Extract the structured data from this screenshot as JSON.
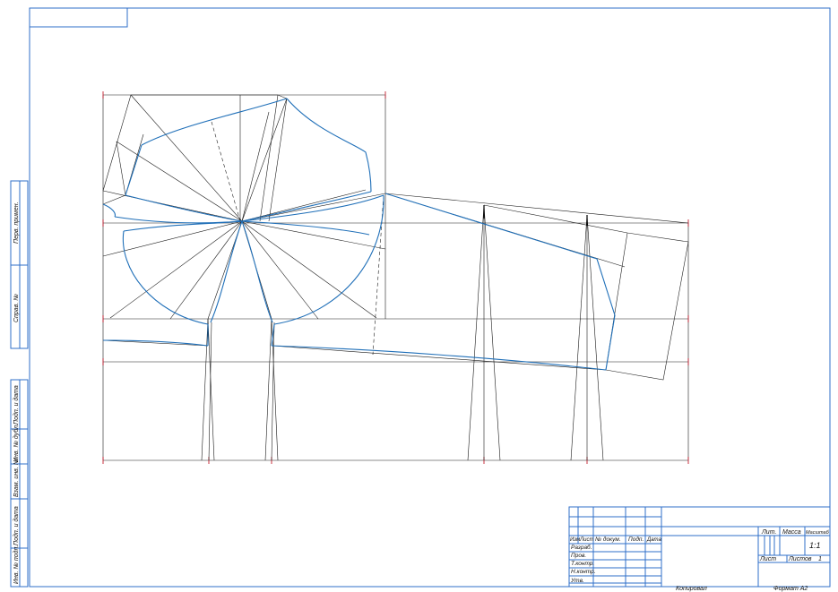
{
  "side_stamp": {
    "labels": [
      "Перв. примен.",
      "Справ. №",
      "Подп. и дата",
      "Инв. № дубл.",
      "Взам. инв. №",
      "Подп. и дата",
      "Инв. № подп."
    ]
  },
  "title_block": {
    "columns": [
      "Изм",
      "Лист",
      "№ докум.",
      "Подп.",
      "Дата"
    ],
    "roles": [
      "Разраб.",
      "Пров.",
      "Т.контр.",
      "Н.контр.",
      "Утв."
    ],
    "lit_label": "Лит.",
    "mass_label": "Масса",
    "scale_label": "Масштаб",
    "scale_value": "1:1",
    "sheet_label": "Лист",
    "sheets_label": "Листов",
    "sheets_value": "1"
  },
  "footer": {
    "copied_label": "Копировал",
    "format_label": "Формат A2"
  },
  "colors": {
    "frame": "#2f6fc9",
    "pattern": "#1f6fb8",
    "construction": "#1b1b1b",
    "grid_marks": "#c21e2e"
  }
}
